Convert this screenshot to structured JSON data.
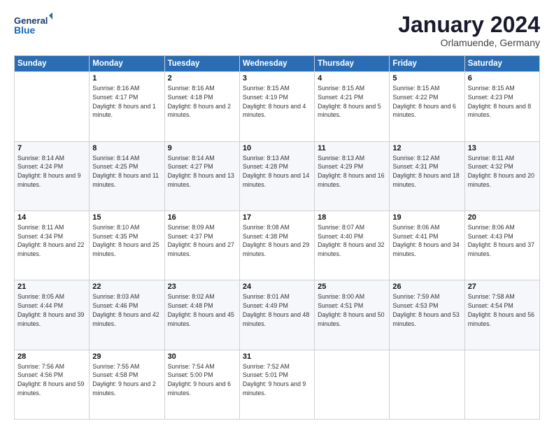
{
  "header": {
    "logo_line1": "General",
    "logo_line2": "Blue",
    "month_title": "January 2024",
    "location": "Orlamuende, Germany"
  },
  "weekdays": [
    "Sunday",
    "Monday",
    "Tuesday",
    "Wednesday",
    "Thursday",
    "Friday",
    "Saturday"
  ],
  "weeks": [
    [
      {
        "day": "",
        "sunrise": "",
        "sunset": "",
        "daylight": ""
      },
      {
        "day": "1",
        "sunrise": "Sunrise: 8:16 AM",
        "sunset": "Sunset: 4:17 PM",
        "daylight": "Daylight: 8 hours and 1 minute."
      },
      {
        "day": "2",
        "sunrise": "Sunrise: 8:16 AM",
        "sunset": "Sunset: 4:18 PM",
        "daylight": "Daylight: 8 hours and 2 minutes."
      },
      {
        "day": "3",
        "sunrise": "Sunrise: 8:15 AM",
        "sunset": "Sunset: 4:19 PM",
        "daylight": "Daylight: 8 hours and 4 minutes."
      },
      {
        "day": "4",
        "sunrise": "Sunrise: 8:15 AM",
        "sunset": "Sunset: 4:21 PM",
        "daylight": "Daylight: 8 hours and 5 minutes."
      },
      {
        "day": "5",
        "sunrise": "Sunrise: 8:15 AM",
        "sunset": "Sunset: 4:22 PM",
        "daylight": "Daylight: 8 hours and 6 minutes."
      },
      {
        "day": "6",
        "sunrise": "Sunrise: 8:15 AM",
        "sunset": "Sunset: 4:23 PM",
        "daylight": "Daylight: 8 hours and 8 minutes."
      }
    ],
    [
      {
        "day": "7",
        "sunrise": "Sunrise: 8:14 AM",
        "sunset": "Sunset: 4:24 PM",
        "daylight": "Daylight: 8 hours and 9 minutes."
      },
      {
        "day": "8",
        "sunrise": "Sunrise: 8:14 AM",
        "sunset": "Sunset: 4:25 PM",
        "daylight": "Daylight: 8 hours and 11 minutes."
      },
      {
        "day": "9",
        "sunrise": "Sunrise: 8:14 AM",
        "sunset": "Sunset: 4:27 PM",
        "daylight": "Daylight: 8 hours and 13 minutes."
      },
      {
        "day": "10",
        "sunrise": "Sunrise: 8:13 AM",
        "sunset": "Sunset: 4:28 PM",
        "daylight": "Daylight: 8 hours and 14 minutes."
      },
      {
        "day": "11",
        "sunrise": "Sunrise: 8:13 AM",
        "sunset": "Sunset: 4:29 PM",
        "daylight": "Daylight: 8 hours and 16 minutes."
      },
      {
        "day": "12",
        "sunrise": "Sunrise: 8:12 AM",
        "sunset": "Sunset: 4:31 PM",
        "daylight": "Daylight: 8 hours and 18 minutes."
      },
      {
        "day": "13",
        "sunrise": "Sunrise: 8:11 AM",
        "sunset": "Sunset: 4:32 PM",
        "daylight": "Daylight: 8 hours and 20 minutes."
      }
    ],
    [
      {
        "day": "14",
        "sunrise": "Sunrise: 8:11 AM",
        "sunset": "Sunset: 4:34 PM",
        "daylight": "Daylight: 8 hours and 22 minutes."
      },
      {
        "day": "15",
        "sunrise": "Sunrise: 8:10 AM",
        "sunset": "Sunset: 4:35 PM",
        "daylight": "Daylight: 8 hours and 25 minutes."
      },
      {
        "day": "16",
        "sunrise": "Sunrise: 8:09 AM",
        "sunset": "Sunset: 4:37 PM",
        "daylight": "Daylight: 8 hours and 27 minutes."
      },
      {
        "day": "17",
        "sunrise": "Sunrise: 8:08 AM",
        "sunset": "Sunset: 4:38 PM",
        "daylight": "Daylight: 8 hours and 29 minutes."
      },
      {
        "day": "18",
        "sunrise": "Sunrise: 8:07 AM",
        "sunset": "Sunset: 4:40 PM",
        "daylight": "Daylight: 8 hours and 32 minutes."
      },
      {
        "day": "19",
        "sunrise": "Sunrise: 8:06 AM",
        "sunset": "Sunset: 4:41 PM",
        "daylight": "Daylight: 8 hours and 34 minutes."
      },
      {
        "day": "20",
        "sunrise": "Sunrise: 8:06 AM",
        "sunset": "Sunset: 4:43 PM",
        "daylight": "Daylight: 8 hours and 37 minutes."
      }
    ],
    [
      {
        "day": "21",
        "sunrise": "Sunrise: 8:05 AM",
        "sunset": "Sunset: 4:44 PM",
        "daylight": "Daylight: 8 hours and 39 minutes."
      },
      {
        "day": "22",
        "sunrise": "Sunrise: 8:03 AM",
        "sunset": "Sunset: 4:46 PM",
        "daylight": "Daylight: 8 hours and 42 minutes."
      },
      {
        "day": "23",
        "sunrise": "Sunrise: 8:02 AM",
        "sunset": "Sunset: 4:48 PM",
        "daylight": "Daylight: 8 hours and 45 minutes."
      },
      {
        "day": "24",
        "sunrise": "Sunrise: 8:01 AM",
        "sunset": "Sunset: 4:49 PM",
        "daylight": "Daylight: 8 hours and 48 minutes."
      },
      {
        "day": "25",
        "sunrise": "Sunrise: 8:00 AM",
        "sunset": "Sunset: 4:51 PM",
        "daylight": "Daylight: 8 hours and 50 minutes."
      },
      {
        "day": "26",
        "sunrise": "Sunrise: 7:59 AM",
        "sunset": "Sunset: 4:53 PM",
        "daylight": "Daylight: 8 hours and 53 minutes."
      },
      {
        "day": "27",
        "sunrise": "Sunrise: 7:58 AM",
        "sunset": "Sunset: 4:54 PM",
        "daylight": "Daylight: 8 hours and 56 minutes."
      }
    ],
    [
      {
        "day": "28",
        "sunrise": "Sunrise: 7:56 AM",
        "sunset": "Sunset: 4:56 PM",
        "daylight": "Daylight: 8 hours and 59 minutes."
      },
      {
        "day": "29",
        "sunrise": "Sunrise: 7:55 AM",
        "sunset": "Sunset: 4:58 PM",
        "daylight": "Daylight: 9 hours and 2 minutes."
      },
      {
        "day": "30",
        "sunrise": "Sunrise: 7:54 AM",
        "sunset": "Sunset: 5:00 PM",
        "daylight": "Daylight: 9 hours and 6 minutes."
      },
      {
        "day": "31",
        "sunrise": "Sunrise: 7:52 AM",
        "sunset": "Sunset: 5:01 PM",
        "daylight": "Daylight: 9 hours and 9 minutes."
      },
      {
        "day": "",
        "sunrise": "",
        "sunset": "",
        "daylight": ""
      },
      {
        "day": "",
        "sunrise": "",
        "sunset": "",
        "daylight": ""
      },
      {
        "day": "",
        "sunrise": "",
        "sunset": "",
        "daylight": ""
      }
    ]
  ]
}
